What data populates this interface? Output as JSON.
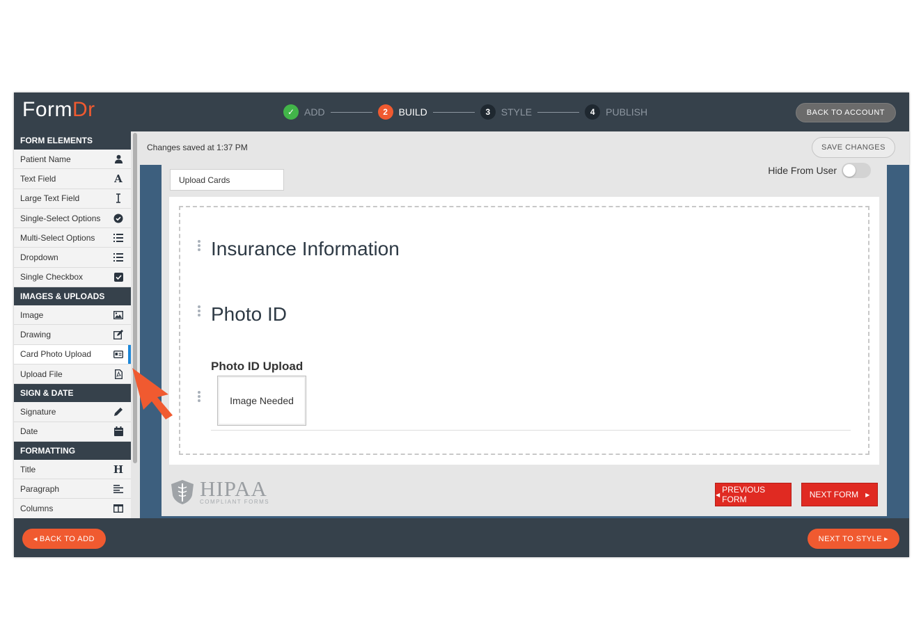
{
  "app": {
    "logo_form": "Form",
    "logo_dr": "Dr",
    "back_to_account": "BACK TO ACCOUNT"
  },
  "steps": [
    {
      "number": "✓",
      "label": "ADD",
      "state": "done"
    },
    {
      "number": "2",
      "label": "BUILD",
      "state": "active"
    },
    {
      "number": "3",
      "label": "STYLE",
      "state": "todo"
    },
    {
      "number": "4",
      "label": "PUBLISH",
      "state": "todo"
    }
  ],
  "sidebar": {
    "sections": [
      {
        "title": "FORM ELEMENTS",
        "items": [
          {
            "label": "Patient Name",
            "icon": "user-icon"
          },
          {
            "label": "Text Field",
            "icon": "text-a-icon"
          },
          {
            "label": "Large Text Field",
            "icon": "text-cursor-icon"
          },
          {
            "label": "Single-Select Options",
            "icon": "check-circle-icon"
          },
          {
            "label": "Multi-Select Options",
            "icon": "list-icon"
          },
          {
            "label": "Dropdown",
            "icon": "list-icon"
          },
          {
            "label": "Single Checkbox",
            "icon": "checkbox-icon"
          }
        ]
      },
      {
        "title": "IMAGES & UPLOADS",
        "items": [
          {
            "label": "Image",
            "icon": "image-icon"
          },
          {
            "label": "Drawing",
            "icon": "edit-icon"
          },
          {
            "label": "Card Photo Upload",
            "icon": "id-card-icon",
            "active": true
          },
          {
            "label": "Upload File",
            "icon": "pdf-file-icon"
          }
        ]
      },
      {
        "title": "SIGN & DATE",
        "items": [
          {
            "label": "Signature",
            "icon": "pencil-icon"
          },
          {
            "label": "Date",
            "icon": "calendar-icon"
          }
        ]
      },
      {
        "title": "FORMATTING",
        "items": [
          {
            "label": "Title",
            "icon": "heading-icon"
          },
          {
            "label": "Paragraph",
            "icon": "align-left-icon"
          },
          {
            "label": "Columns",
            "icon": "columns-icon"
          }
        ]
      }
    ]
  },
  "main": {
    "saved_status": "Changes saved at 1:37 PM",
    "save_changes": "SAVE CHANGES",
    "section_name_value": "Upload Cards",
    "hide_from_user_label": "Hide From User",
    "hide_from_user_on": false,
    "heading_insurance": "Insurance Information",
    "heading_photo_id": "Photo ID",
    "upload_field_label": "Photo ID Upload",
    "image_placeholder": "Image Needed",
    "hipaa_big": "HIPAA",
    "hipaa_small": "COMPLIANT FORMS",
    "previous_form": "PREVIOUS FORM",
    "next_form": "NEXT FORM"
  },
  "footer": {
    "back_to_add": "BACK TO ADD",
    "next_to_style": "NEXT TO STYLE"
  },
  "colors": {
    "topbar": "#36414b",
    "accent_orange": "#f05a30",
    "done_green": "#42b549",
    "frame_blue": "#3d5f7e",
    "button_red": "#e02a22",
    "active_marker": "#1c87d8"
  }
}
